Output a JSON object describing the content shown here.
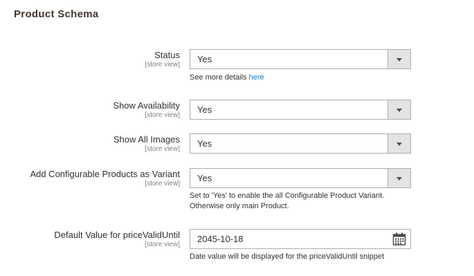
{
  "section": {
    "title": "Product Schema"
  },
  "fields": {
    "status": {
      "label": "Status",
      "scope": "[store view]",
      "value": "Yes",
      "note_prefix": "See more details ",
      "note_link": "here"
    },
    "show_availability": {
      "label": "Show Availability",
      "scope": "[store view]",
      "value": "Yes"
    },
    "show_all_images": {
      "label": "Show All Images",
      "scope": "[store view]",
      "value": "Yes"
    },
    "add_configurable": {
      "label": "Add Configurable Products as Variant",
      "scope": "[store view]",
      "value": "Yes",
      "note_line1": "Set to 'Yes' to enable the all Configurable Product Variant.",
      "note_line2": "Otherwise only main Product."
    },
    "price_valid_until": {
      "label": "Default Value for priceValidUntil",
      "scope": "[store view]",
      "value": "2045-10-18",
      "note": "Date value will be displayed for the priceValidUntil snippet",
      "icon": "calendar-icon"
    }
  },
  "icons": {
    "select_arrow": "chevron-down-icon",
    "date_picker": "calendar-icon"
  },
  "colors": {
    "link": "#1979c3",
    "border": "#adadad",
    "select_button": "#e3e3e3"
  }
}
